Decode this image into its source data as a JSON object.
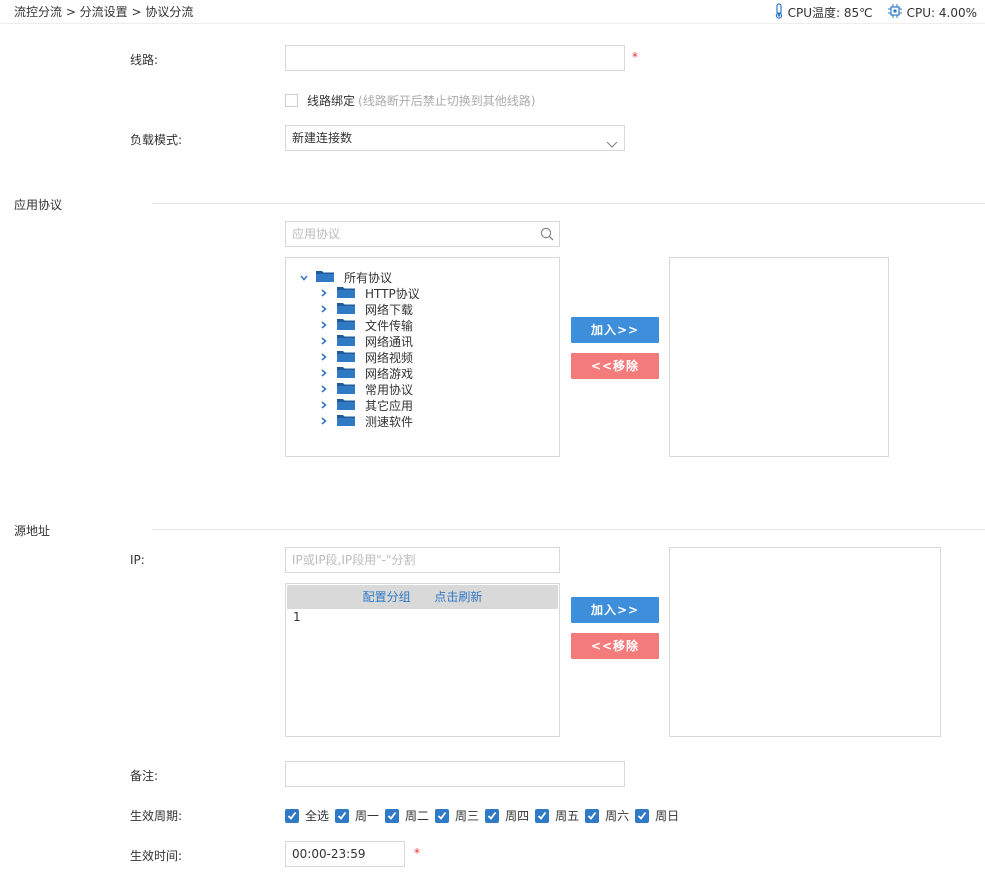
{
  "breadcrumb": "流控分流 > 分流设置 > 协议分流",
  "status": {
    "cpu_temp": "CPU温度: 85℃",
    "cpu_usage": "CPU: 4.00%"
  },
  "form": {
    "line_label": "线路:",
    "line_value": "",
    "required_mark": "*",
    "bind_label": "线路绑定",
    "bind_hint": "(线路断开后禁止切换到其他线路)",
    "load_mode_label": "负载模式:",
    "load_mode_value": "新建连接数"
  },
  "app_protocol": {
    "section_title": "应用协议",
    "search_placeholder": "应用协议",
    "tree_root": "所有协议",
    "tree_items": [
      "HTTP协议",
      "网络下载",
      "文件传输",
      "网络通讯",
      "网络视频",
      "网络游戏",
      "常用协议",
      "其它应用",
      "测速软件"
    ],
    "add_button": "加入>>",
    "remove_button": "<<移除"
  },
  "source": {
    "section_title": "源地址",
    "ip_label": "IP:",
    "ip_placeholder": "IP或IP段,IP段用\"-\"分割",
    "config_group_link": "配置分组",
    "refresh_link": "点击刷新",
    "list_first_line": "1",
    "add_button": "加入>>",
    "remove_button": "<<移除"
  },
  "remark": {
    "label": "备注:",
    "value": ""
  },
  "period": {
    "label": "生效周期:",
    "options": [
      "全选",
      "周一",
      "周二",
      "周三",
      "周四",
      "周五",
      "周六",
      "周日"
    ]
  },
  "time": {
    "label": "生效时间:",
    "value": "00:00-23:59",
    "required_mark": "*"
  },
  "colors": {
    "accent": "#2f79c5",
    "add_button": "#3d8edb",
    "remove_button": "#f47b7b",
    "required": "#e33333"
  }
}
